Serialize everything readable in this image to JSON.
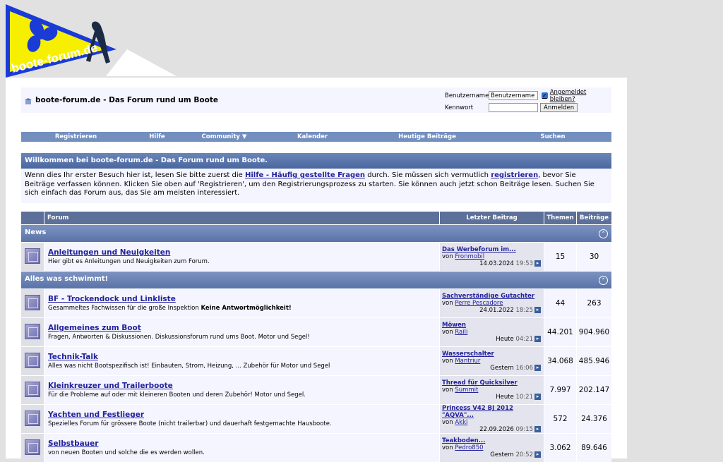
{
  "logo": {
    "text": "boote-forum.de"
  },
  "breadcrumb": {
    "title": "boote-forum.de - Das Forum rund um Boote"
  },
  "login": {
    "username_label": "Benutzername",
    "username_value": "Benutzername",
    "remember_label": "Angemeldet bleiben?",
    "password_label": "Kennwort",
    "login_button": "Anmelden"
  },
  "nav": {
    "items": [
      "Registrieren",
      "Hilfe",
      "Community ▼",
      "Kalender",
      "Heutige Beiträge",
      "Suchen"
    ]
  },
  "welcome": {
    "title": "Willkommen bei boote-forum.de - Das Forum rund um Boote.",
    "text1": "Wenn dies Ihr erster Besuch hier ist, lesen Sie bitte zuerst die ",
    "faq_link": "Hilfe - Häufig gestellte Fragen",
    "text2": " durch. Sie müssen sich vermutlich ",
    "register_link": "registrieren",
    "text3": ", bevor Sie Beiträge verfassen können. Klicken Sie oben auf 'Registrieren', um den Registrierungsprozess zu starten. Sie können auch jetzt schon Beiträge lesen. Suchen Sie sich einfach das Forum aus, das Sie am meisten interessiert."
  },
  "table": {
    "headers": {
      "forum": "Forum",
      "last_post": "Letzter Beitrag",
      "threads": "Themen",
      "posts": "Beiträge"
    },
    "categories": [
      {
        "name": "News",
        "forums": [
          {
            "name": "Anleitungen und Neuigkeiten",
            "desc": "Hier gibt es Anleitungen und Neuigkeiten zum Forum.",
            "desc_bold": "",
            "last_title": "Das Werbeforum im...",
            "by": "von",
            "last_user": "Fronmobil",
            "last_date": "14.03.2024",
            "last_time": "19:53",
            "threads": "15",
            "posts": "30"
          }
        ]
      },
      {
        "name": "Alles was schwimmt!",
        "forums": [
          {
            "name": "BF - Trockendock und Linkliste",
            "desc": "Gesammeltes Fachwissen für die große Inspektion ",
            "desc_bold": "Keine Antwortmöglichkeit!",
            "last_title": "Sachverständige Gutachter",
            "by": "von",
            "last_user": "Perre Pescadore",
            "last_date": "24.01.2022",
            "last_time": "18:25",
            "threads": "44",
            "posts": "263"
          },
          {
            "name": "Allgemeines zum Boot",
            "desc": "Fragen, Antworten & Diskussionen. Diskussionsforum rund ums Boot. Motor und Segel!",
            "desc_bold": "",
            "last_title": "Möwen",
            "by": "von",
            "last_user": "Raili",
            "last_date": "Heute",
            "last_time": "04:21",
            "threads": "44.201",
            "posts": "904.960"
          },
          {
            "name": "Technik-Talk",
            "desc": "Alles was nicht Bootspezifisch ist! Einbauten, Strom, Heizung, ... Zubehör für Motor und Segel",
            "desc_bold": "",
            "last_title": "Wasserschalter",
            "by": "von",
            "last_user": "Mantriur",
            "last_date": "Gestern",
            "last_time": "16:06",
            "threads": "34.068",
            "posts": "485.946"
          },
          {
            "name": "Kleinkreuzer und Trailerboote",
            "desc": "Für die Probleme auf oder mit kleineren Booten und deren Zubehör! Motor und Segel.",
            "desc_bold": "",
            "last_title": "Thread für Quicksilver",
            "by": "von",
            "last_user": "Summit",
            "last_date": "Heute",
            "last_time": "10:21",
            "threads": "7.997",
            "posts": "202.147"
          },
          {
            "name": "Yachten und Festlieger",
            "desc": "Spezielles Forum für grössere Boote (nicht trailerbar) und dauerhaft festgemachte Hausboote.",
            "desc_bold": "",
            "last_title": "Princess V42 BJ 2012 \"AQVA\"...",
            "by": "von",
            "last_user": "Akki",
            "last_date": "22.09.2026",
            "last_time": "09:15",
            "threads": "572",
            "posts": "24.376"
          },
          {
            "name": "Selbstbauer",
            "desc": "von neuen Booten und solche die es werden wollen.",
            "desc_bold": "",
            "last_title": "Teakboden...",
            "by": "von",
            "last_user": "Pedro850",
            "last_date": "Gestern",
            "last_time": "20:52",
            "threads": "3.062",
            "posts": "89.646"
          }
        ]
      }
    ]
  },
  "colors": {
    "nav": "#738fbf",
    "header": "#5c7099",
    "link": "#22229c",
    "logo_blue": "#1a3bd6",
    "logo_yellow": "#f6f000"
  }
}
